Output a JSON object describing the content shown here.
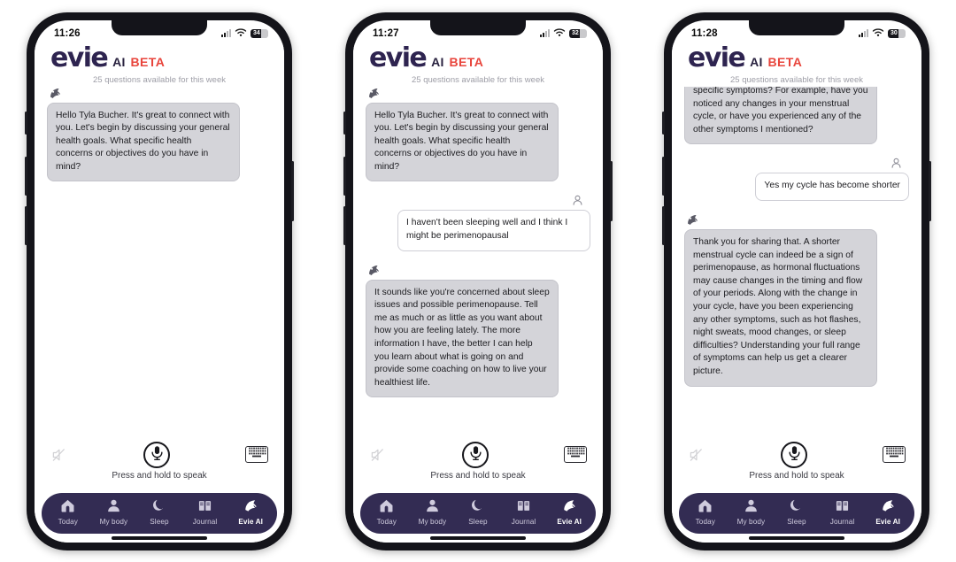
{
  "app": {
    "logo_word": "evie",
    "logo_ai": "AI",
    "logo_beta": "BETA",
    "quota_text": "25 questions available for this week",
    "press_hold_label": "Press and hold to speak",
    "accent_purple": "#332c53",
    "logo_purple": "#2e2450",
    "beta_red": "#e8453c",
    "bot_bubble_bg": "#d4d4d9",
    "user_bubble_bg": "#ffffff"
  },
  "nav": {
    "items": [
      {
        "label": "Today",
        "icon": "home-icon",
        "active": false
      },
      {
        "label": "My body",
        "icon": "person-icon",
        "active": false
      },
      {
        "label": "Sleep",
        "icon": "moon-icon",
        "active": false
      },
      {
        "label": "Journal",
        "icon": "book-icon",
        "active": false
      },
      {
        "label": "Evie AI",
        "icon": "evie-bird-icon",
        "active": true
      }
    ]
  },
  "phones": [
    {
      "status": {
        "time": "11:26",
        "battery_level": "34"
      },
      "clipped_top": false,
      "messages": [
        {
          "role": "bot",
          "text": " Hello Tyla Bucher.  It's great to connect with you.  Let's begin by discussing your general health goals.  What specific health concerns or objectives do you have in mind?"
        }
      ]
    },
    {
      "status": {
        "time": "11:27",
        "battery_level": "32"
      },
      "clipped_top": false,
      "messages": [
        {
          "role": "bot",
          "text": " Hello Tyla Bucher.  It's great to connect with you.  Let's begin by discussing your general health goals.  What specific health concerns or objectives do you have in mind?"
        },
        {
          "role": "user",
          "text": "I haven't been sleeping well and I think I might be perimenopausal"
        },
        {
          "role": "bot",
          "text": " It sounds like you're concerned about sleep issues and possible perimenopause.  Tell me as much or as little as you want about how you are feeling lately.  The more information I have, the better I can help you learn about what is going on and provide some coaching on how to live your healthiest life."
        }
      ]
    },
    {
      "status": {
        "time": "11:28",
        "battery_level": "30"
      },
      "clipped_top": true,
      "messages": [
        {
          "role": "bot",
          "text": "fatigue. Can you share more about your specific symptoms?  For example, have you noticed any changes in your menstrual cycle, or have you experienced any of the other symptoms I mentioned?"
        },
        {
          "role": "user",
          "text": "Yes my cycle has become shorter"
        },
        {
          "role": "bot",
          "text": " Thank you for sharing that.  A shorter menstrual cycle can indeed be a sign of perimenopause, as hormonal fluctuations may cause changes in the timing and flow of your periods. Along with the change in your cycle, have you been experiencing any other symptoms, such as hot flashes, night sweats, mood changes, or sleep difficulties?  Understanding your full range of symptoms can help us get a clearer picture."
        }
      ]
    }
  ]
}
